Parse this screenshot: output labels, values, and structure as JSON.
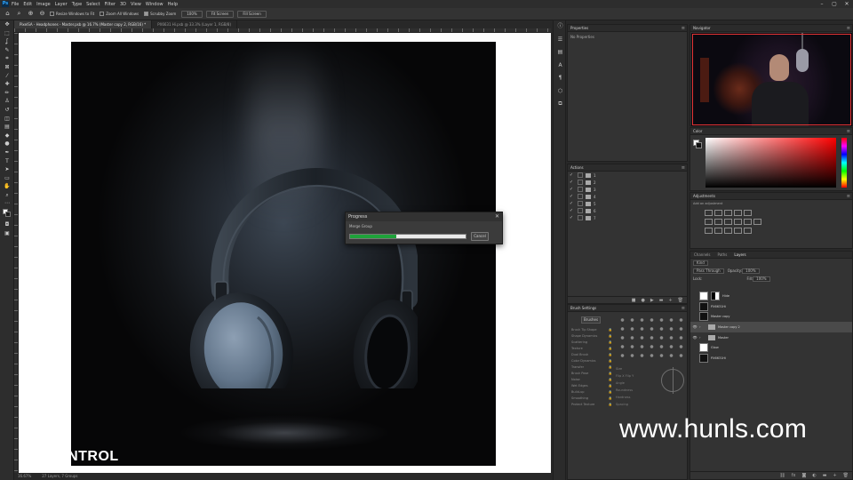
{
  "menubar": {
    "app_logo": "Ps",
    "items": [
      "File",
      "Edit",
      "Image",
      "Layer",
      "Type",
      "Select",
      "Filter",
      "3D",
      "View",
      "Window",
      "Help"
    ],
    "window_controls": [
      "–",
      "▢",
      "✕"
    ]
  },
  "options_bar": {
    "resize_windows": "Resize Windows to Fit",
    "zoom_all": "Zoom All Windows",
    "scrubby_zoom": "Scrubby Zoom",
    "btn_100": "100%",
    "fit_screen": "Fit Screen",
    "fill_screen": "Fill Screen"
  },
  "tabs": [
    {
      "label": "PixelSA - Headphones - Master.psb @ 16.7% (Master copy 2, RGB/16) *",
      "active": true
    },
    {
      "label": "PX6631 Hi.psb @ 33.3% (Layer 1, RGB/8)",
      "active": false
    }
  ],
  "status": {
    "zoom": "16.67%",
    "info": "27 Layers, 7 Groups"
  },
  "canvas": {
    "watermark_left": "L-CONTROL"
  },
  "progress": {
    "title": "Progress",
    "label": "Merge Group",
    "value": 0.4,
    "cancel": "Cancel",
    "accent": "#1fa23a"
  },
  "properties": {
    "title": "Properties",
    "empty_text": "No Properties"
  },
  "actions": {
    "title": "Actions",
    "rows": [
      "1",
      "2",
      "3",
      "4",
      "5",
      "6",
      "7"
    ],
    "footer_icons": [
      "■",
      "●",
      "▶",
      "▬",
      "+",
      "🗑"
    ]
  },
  "brush_settings": {
    "title": "Brush Settings",
    "brushes_btn": "Brushes",
    "options": [
      "Brush Tip Shape",
      "Shape Dynamics",
      "Scattering",
      "Texture",
      "Dual Brush",
      "Color Dynamics",
      "Transfer",
      "Brush Pose",
      "Noise",
      "Wet Edges",
      "Build-up",
      "Smoothing",
      "Protect Texture"
    ],
    "fields": [
      "Size",
      "Flip X  Flip Y",
      "Angle",
      "Roundness",
      "Hardness",
      "Spacing"
    ]
  },
  "navigator": {
    "title": "Navigator"
  },
  "color": {
    "title": "Color"
  },
  "adjustments": {
    "title": "Adjustments",
    "subtitle": "Add an adjustment"
  },
  "layers": {
    "tabs": [
      "Channels",
      "Paths",
      "Layers"
    ],
    "kind": "Kind",
    "blend": "Pass Through",
    "opacity_label": "Opacity:",
    "opacity": "100%",
    "lock_label": "Lock:",
    "fill_label": "Fill:",
    "fill": "100%",
    "rows": [
      {
        "name": "Hide",
        "type": "layer",
        "visible": false,
        "selected": false
      },
      {
        "name": "PX6631Hi",
        "type": "layer",
        "visible": false,
        "selected": false
      },
      {
        "name": "Master copy",
        "type": "layer",
        "visible": false,
        "selected": false
      },
      {
        "name": "Master copy 2",
        "type": "group",
        "visible": true,
        "selected": true
      },
      {
        "name": "Master",
        "type": "group",
        "visible": true,
        "selected": false
      },
      {
        "name": "Glow",
        "type": "layer",
        "visible": false,
        "selected": false
      },
      {
        "name": "PX6631Hi",
        "type": "layer",
        "visible": false,
        "selected": false
      }
    ]
  },
  "watermark": "www.hunls.com"
}
